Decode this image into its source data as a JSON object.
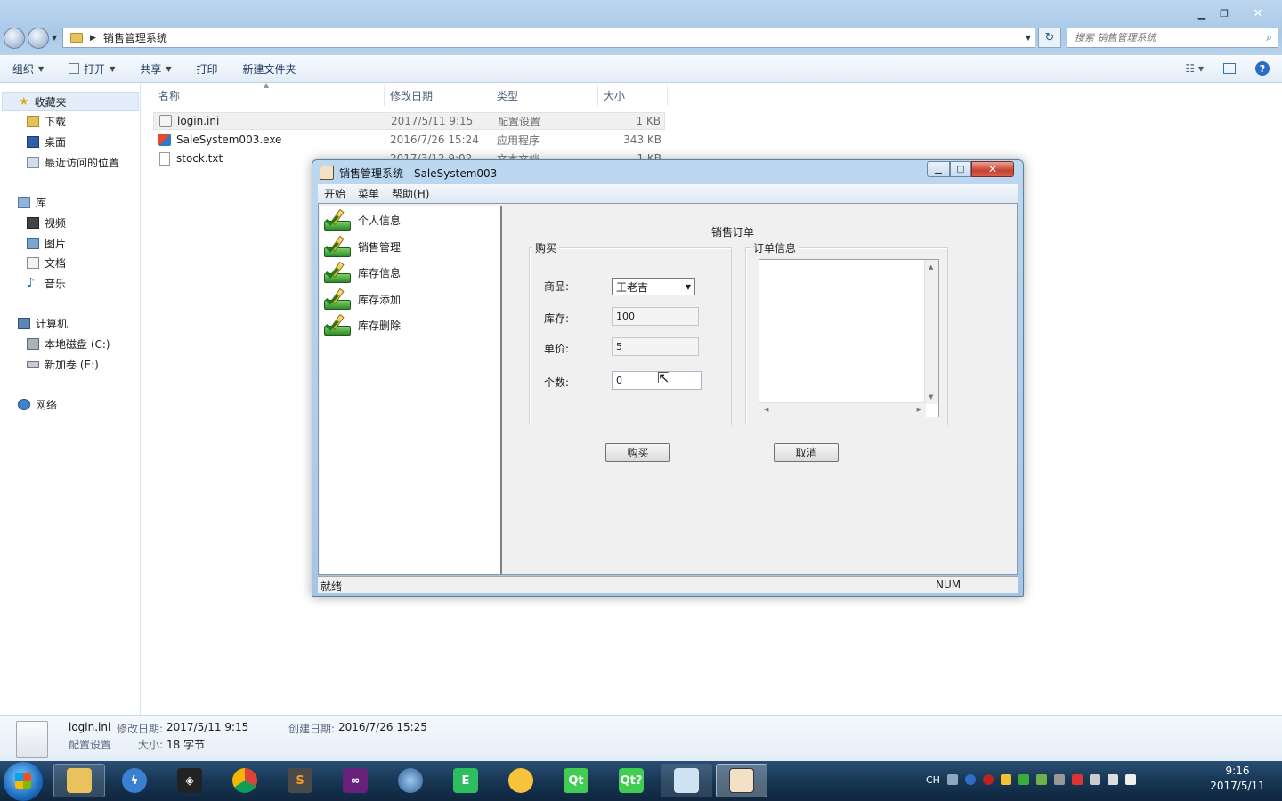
{
  "explorer": {
    "breadcrumb": "销售管理系统",
    "search_placeholder": "搜索 销售管理系统",
    "toolbar": {
      "organize": "组织",
      "open": "打开",
      "share": "共享",
      "print": "打印",
      "new_folder": "新建文件夹"
    },
    "nav": {
      "favorites": "收藏夹",
      "downloads": "下载",
      "desktop": "桌面",
      "recent": "最近访问的位置",
      "libraries": "库",
      "videos": "视频",
      "pictures": "图片",
      "documents": "文档",
      "music": "音乐",
      "computer": "计算机",
      "disk_c": "本地磁盘 (C:)",
      "disk_e": "新加卷 (E:)",
      "network": "网络"
    },
    "columns": {
      "name": "名称",
      "date": "修改日期",
      "type": "类型",
      "size": "大小"
    },
    "files": [
      {
        "name": "login.ini",
        "date": "2017/5/11 9:15",
        "type": "配置设置",
        "size": "1 KB"
      },
      {
        "name": "SaleSystem003.exe",
        "date": "2016/7/26 15:24",
        "type": "应用程序",
        "size": "343 KB"
      },
      {
        "name": "stock.txt",
        "date": "2017/3/12 9:02",
        "type": "文本文档",
        "size": "1 KB"
      }
    ],
    "details": {
      "filename": "login.ini",
      "modified_label": "修改日期:",
      "modified": "2017/5/11 9:15",
      "created_label": "创建日期:",
      "created": "2016/7/26 15:25",
      "type": "配置设置",
      "size_label": "大小:",
      "size": "18 字节"
    }
  },
  "app": {
    "title": "销售管理系统 - SaleSystem003",
    "menu": [
      "开始",
      "菜单",
      "帮助(H)"
    ],
    "tree": [
      "个人信息",
      "销售管理",
      "库存信息",
      "库存添加",
      "库存删除"
    ],
    "form": {
      "heading": "销售订单",
      "buy_group": "购买",
      "order_group": "订单信息",
      "product_label": "商品:",
      "product_value": "王老吉",
      "stock_label": "库存:",
      "stock_value": "100",
      "price_label": "单价:",
      "price_value": "5",
      "qty_label": "个数:",
      "qty_value": "0",
      "buy_button": "购买",
      "cancel_button": "取消"
    },
    "status": {
      "left": "就绪",
      "num": "NUM"
    }
  },
  "taskbar": {
    "lang": "CH",
    "time": "9:16",
    "date": "2017/5/11"
  }
}
